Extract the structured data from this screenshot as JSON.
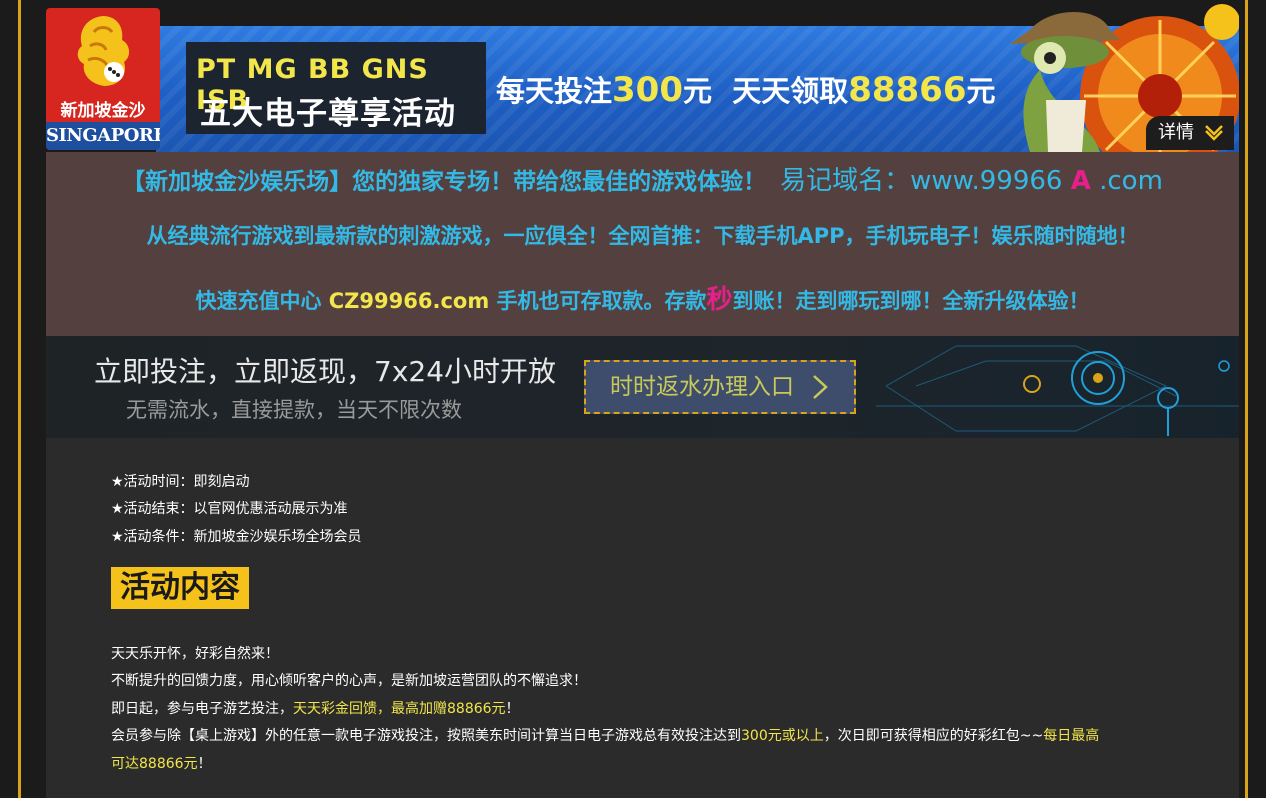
{
  "banner": {
    "logo_cn": "新加坡金沙",
    "logo_en": "SINGAPORE",
    "ad_line1": "PT MG BB GNS ISB",
    "ad_line2": "五大电子尊享活动",
    "ad_mid_a": "每天投注",
    "ad_mid_b": "300",
    "ad_mid_c": "元  天天领取",
    "ad_mid_d": "88866",
    "ad_mid_e": "元",
    "details_label": "详情"
  },
  "notice": {
    "line1_main": "【新加坡金沙娱乐场】您的独家专场！带给您最佳的游戏体验！",
    "line1_domain_prefix": "易记域名：www.99966",
    "line1_domain_mid": "A",
    "line1_domain_suffix": ".com",
    "line2": "从经典流行游戏到最新款的刺激游戏，一应俱全！全网首推：下载手机APP，手机玩电子！娱乐随时随地！",
    "line3_a": "快速充值中心 ",
    "line3_b": "CZ99966.com",
    "line3_c": " 手机也可存取款。存款",
    "line3_d": "秒",
    "line3_e": "到账！走到哪玩到哪！全新升级体验！"
  },
  "promo": {
    "title": "立即投注，立即返现，7x24小时开放",
    "subtitle": "无需流水，直接提款，当天不限次数",
    "button_label": "时时返水办理入口"
  },
  "activity": {
    "time": "★活动时间：即刻启动",
    "end": "★活动结束：以官网优惠活动展示为准",
    "condition": "★活动条件：新加坡金沙娱乐场全场会员",
    "section_title": "活动内容",
    "p1": "天天乐开怀，好彩自然来！",
    "p2": "不断提升的回馈力度，用心倾听客户的心声，是新加坡运营团队的不懈追求！",
    "p3_a": "即日起，参与电子游艺投注，",
    "p3_b": "天天彩金回馈，最高加赠88866元",
    "p3_c": "！",
    "p4_a": "会员参与除【桌上游戏】外的任意一款电子游戏投注，按照美东时间计算当日电子游戏总有效投注达到",
    "p4_b": "300元或以上",
    "p4_c": "，次日即可获得相应的好彩红包~~",
    "p4_d": "每日最高",
    "p5": "可达88866元",
    "p5_end": "！"
  },
  "colors": {
    "accent_gold": "#d9a31a",
    "highlight_yellow": "#f2e64a",
    "notice_cyan": "#33b9e6",
    "notice_pink": "#e6208a",
    "title_bg": "#f5c21b"
  }
}
